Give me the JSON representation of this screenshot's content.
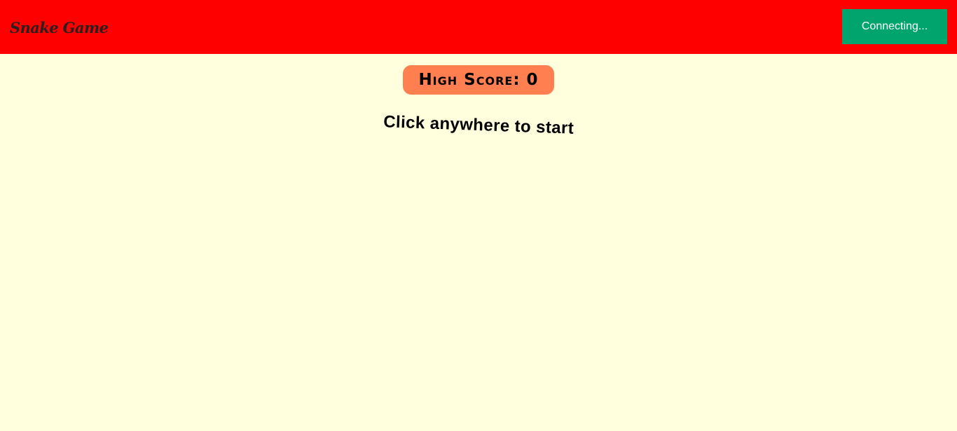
{
  "header": {
    "title": "Snake Game",
    "connect_button": "Connecting..."
  },
  "scoreboard": {
    "label": "High Score:",
    "value": 0
  },
  "game": {
    "start_prompt": "Click anywhere to start"
  },
  "colors": {
    "header_background": "#FF0000",
    "page_background": "#FFFFDD",
    "connect_button": "#00A46C",
    "high_score_badge": "#FF7F50"
  }
}
